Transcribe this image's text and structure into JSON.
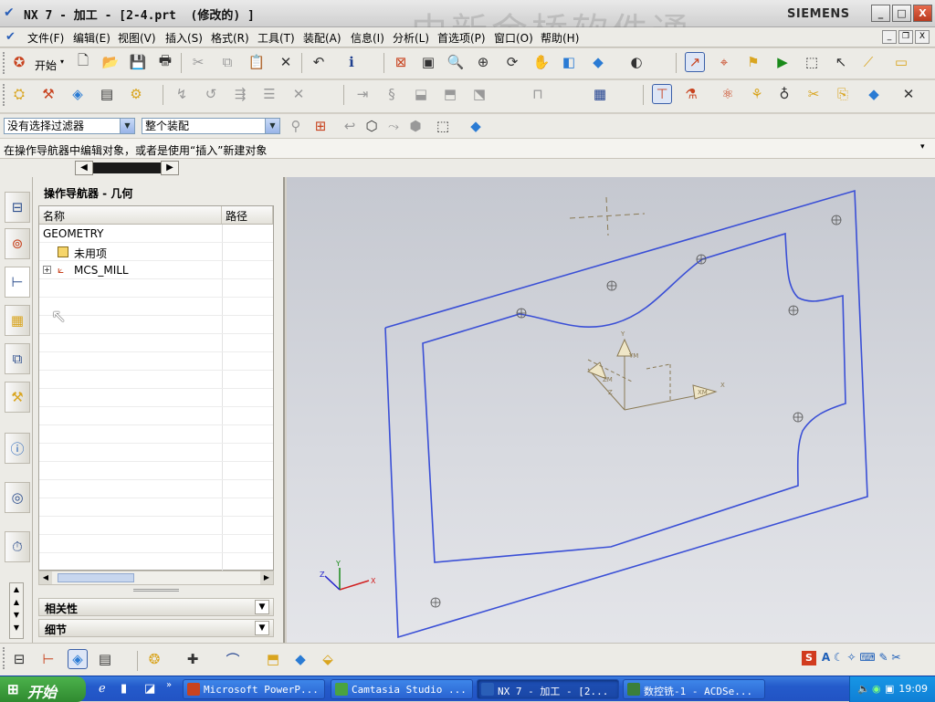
{
  "window": {
    "title": "NX 7 - 加工 - [2-4.prt  (修改的) ]",
    "brand": "SIEMENS",
    "watermark": "中新金桥软件通",
    "minimize": "_",
    "maximize": "□",
    "close": "X"
  },
  "menu": {
    "items": [
      "文件(F)",
      "编辑(E)",
      "视图(V)",
      "插入(S)",
      "格式(R)",
      "工具(T)",
      "装配(A)",
      "信息(I)",
      "分析(L)",
      "首选项(P)",
      "窗口(O)",
      "帮助(H)"
    ]
  },
  "toolbar": {
    "start_label": "开始",
    "filter_combo": "没有选择过滤器",
    "scope_combo": "整个装配"
  },
  "cue": {
    "text": "在操作导航器中编辑对象，或者是使用“插入”新建对象"
  },
  "navigator": {
    "title": "操作导航器 - 几何",
    "col_name": "名称",
    "col_path": "路径",
    "rows": [
      {
        "name": "GEOMETRY"
      },
      {
        "name": "未用项"
      },
      {
        "name": "MCS_MILL"
      }
    ],
    "section_related": "相关性",
    "section_details": "细节"
  },
  "viewport": {
    "axis_labels": {
      "x": "X",
      "y": "Y",
      "z": "Z",
      "xm": "XM",
      "ym": "YM",
      "zm": "ZM"
    },
    "colors": {
      "part": "#3a4fd6",
      "csys": "#8a7a55",
      "triad_x": "#d12020",
      "triad_y": "#1a8a1a",
      "triad_z": "#2222cc"
    }
  },
  "taskbar": {
    "start": "开始",
    "tasks": [
      {
        "label": "Microsoft PowerP...",
        "color": "#c8431f"
      },
      {
        "label": "Camtasia Studio ...",
        "color": "#4aa340"
      },
      {
        "label": "NX 7 - 加工 - [2...",
        "color": "#2a5fb8"
      },
      {
        "label": "数控铣-1 - ACDSe...",
        "color": "#3b7f3b"
      }
    ],
    "clock": "19:09"
  }
}
